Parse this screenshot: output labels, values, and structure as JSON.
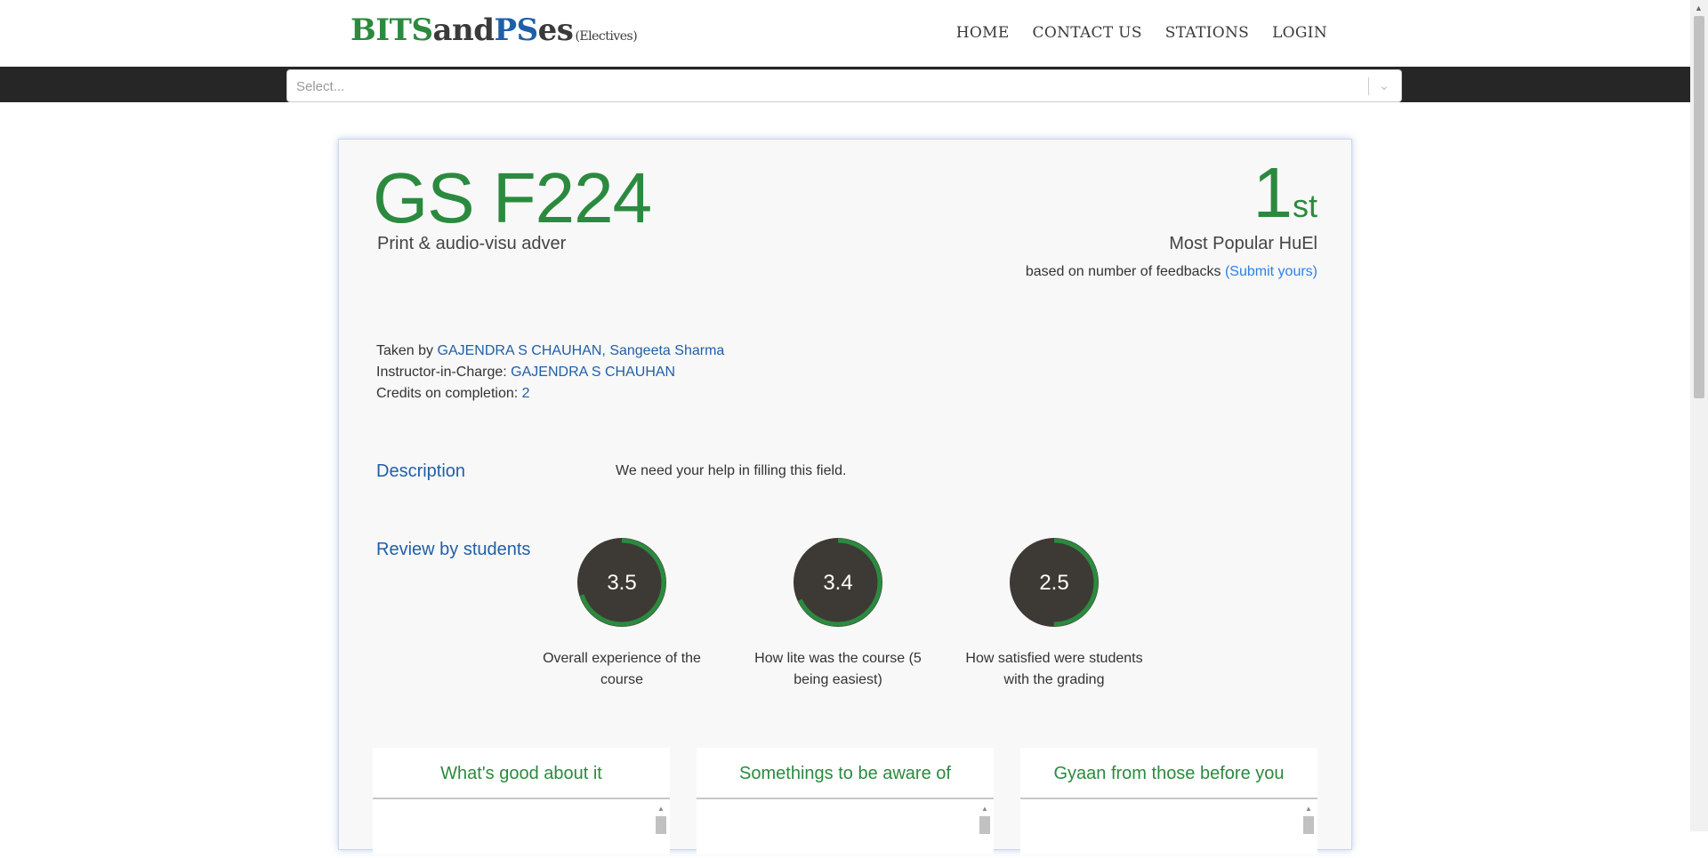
{
  "brand": {
    "part1": "BITS",
    "part2": "and",
    "part3": "PS",
    "part4": "es",
    "suffix": "(Electives)"
  },
  "nav": {
    "home": "HOME",
    "contact": "CONTACT US",
    "stations": "STATIONS",
    "login": "LOGIN"
  },
  "search": {
    "placeholder": "Select..."
  },
  "course": {
    "code": "GS F224",
    "name": "Print & audio-visu adver",
    "rank_number": "1",
    "rank_suffix": "st",
    "popularity": "Most Popular HuEl",
    "basis": "based on number of feedbacks",
    "submit_link": "(Submit yours)",
    "taken_by_label": "Taken by",
    "taken_by": "GAJENDRA S CHAUHAN, Sangeeta Sharma",
    "ic_label": "Instructor-in-Charge:",
    "ic": "GAJENDRA S CHAUHAN",
    "credits_label": "Credits on completion:",
    "credits": "2"
  },
  "description": {
    "label": "Description",
    "text": "We need your help in filling this field."
  },
  "reviews": {
    "label": "Review by students",
    "max": 5,
    "items": [
      {
        "value": "3.5",
        "score": 3.5,
        "label_line1": "Overall experience of the",
        "label_line2": "course"
      },
      {
        "value": "3.4",
        "score": 3.4,
        "label_line1": "How lite was the course (5",
        "label_line2": "being easiest)"
      },
      {
        "value": "2.5",
        "score": 2.5,
        "label_line1": "How satisfied were students",
        "label_line2": "with the grading"
      }
    ]
  },
  "panels": [
    {
      "title": "What's good about it"
    },
    {
      "title": "Somethings to be aware of"
    },
    {
      "title": "Gyaan from those before you"
    }
  ],
  "colors": {
    "brand_green": "#2b8a3e",
    "brand_blue": "#1f5fa8",
    "ring_dark": "#3d3935",
    "ring_green": "#2b8a3e"
  }
}
